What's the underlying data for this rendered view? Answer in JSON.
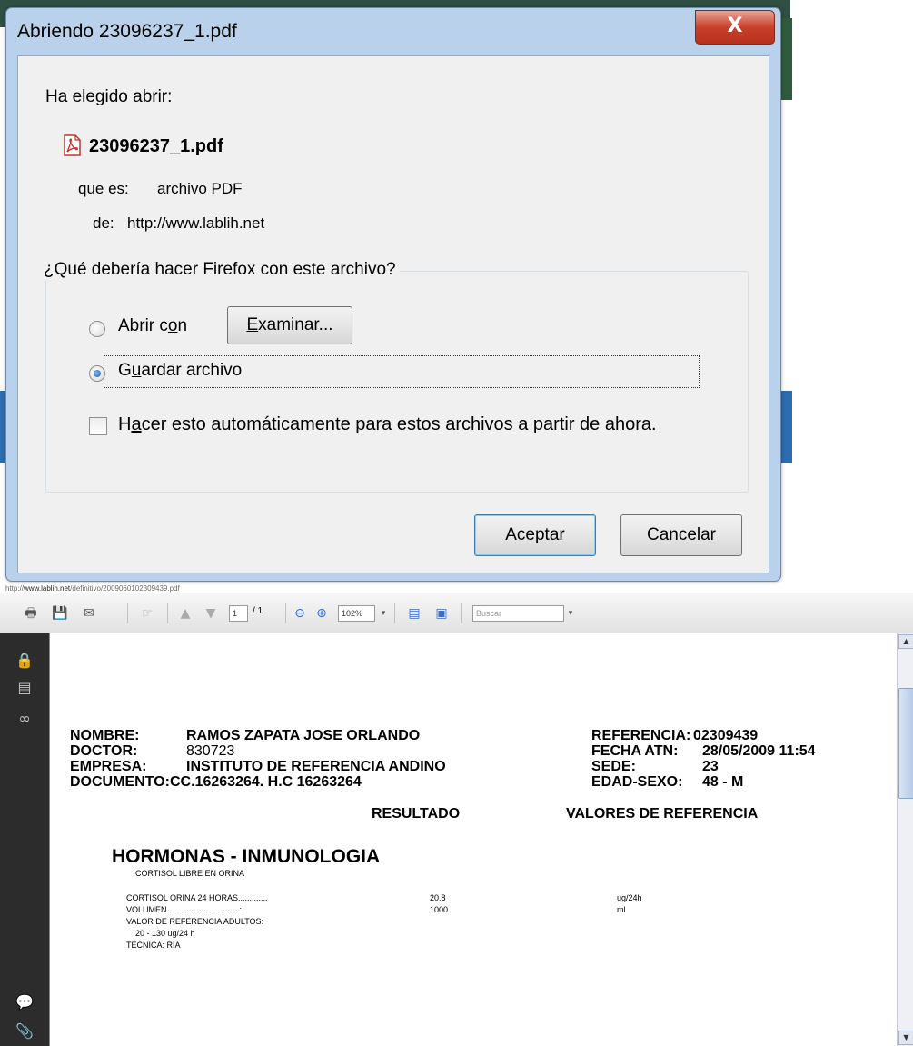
{
  "dialog": {
    "title": "Abriendo 23096237_1.pdf",
    "close_label": "X",
    "intro": "Ha elegido abrir:",
    "filename": "23096237_1.pdf",
    "type_label": "que es:",
    "type_value": "archivo PDF",
    "from_label": "de:",
    "from_value": "http://www.lablih.net",
    "question": "¿Qué debería hacer Firefox con este archivo?",
    "open_with_label_pre": "Abrir c",
    "open_with_label_u": "o",
    "open_with_label_post": "n",
    "browse_label_u": "E",
    "browse_label_post": "xaminar...",
    "save_label_pre": "G",
    "save_label_u": "u",
    "save_label_post": "ardar archivo",
    "auto_label_pre": "H",
    "auto_label_u": "a",
    "auto_label_post": "cer esto automáticamente para estos archivos a partir de ahora.",
    "ok_label": "Aceptar",
    "cancel_label": "Cancelar",
    "selected_option": "Guardar archivo",
    "auto_checked": false
  },
  "status_url": {
    "prefix": "http://",
    "host": "www.lablih.net",
    "path": "/definitivo/2009060102309439.pdf"
  },
  "viewer": {
    "page_current": "1",
    "page_total": "/ 1",
    "zoom": "102%",
    "search_placeholder": "Buscar"
  },
  "report": {
    "nombre_label": "NOMBRE:",
    "nombre_value": "RAMOS ZAPATA JOSE ORLANDO",
    "doctor_label": "DOCTOR:",
    "doctor_value": "830723",
    "empresa_label": "EMPRESA:",
    "empresa_value": "INSTITUTO DE REFERENCIA ANDINO",
    "documento_label": "DOCUMENTO:",
    "documento_value": "CC.16263264. H.C 16263264",
    "referencia_label": "REFERENCIA:",
    "referencia_value": "02309439",
    "fecha_label": "FECHA ATN:",
    "fecha_value": "28/05/2009 11:54",
    "sede_label": "SEDE:",
    "sede_value": "23",
    "edad_label": "EDAD-SEXO:",
    "edad_value": "48 - M",
    "col_resultado": "RESULTADO",
    "col_referencia": "VALORES DE REFERENCIA",
    "section_title": "HORMONAS - INMUNOLOGIA",
    "subsection": "CORTISOL LIBRE EN ORINA",
    "rows": [
      {
        "label": "CORTISOL ORINA 24 HORAS.............",
        "value": "20.8",
        "unit": "ug/24h"
      },
      {
        "label": "VOLUMEN................................:",
        "value": "1000",
        "unit": "ml"
      }
    ],
    "ref_adultos_label": "VALOR DE REFERENCIA ADULTOS:",
    "ref_adultos_value": "20 - 130 ug/24 h",
    "tecnica": "TECNICA: RIA"
  }
}
